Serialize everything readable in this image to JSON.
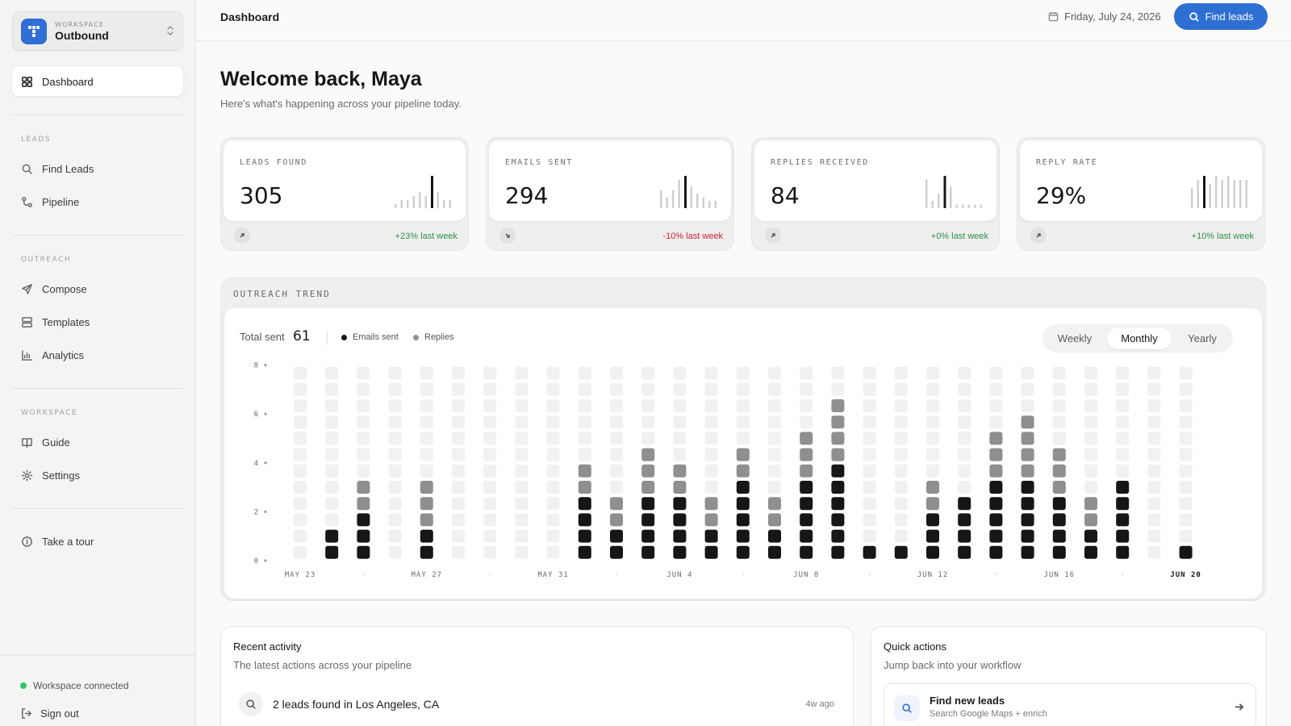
{
  "workspace": {
    "kicker": "WORKSPACE",
    "name": "Outbound"
  },
  "nav": {
    "dashboard": "Dashboard",
    "leads_label": "LEADS",
    "find_leads": "Find Leads",
    "pipeline": "Pipeline",
    "outreach_label": "OUTREACH",
    "compose": "Compose",
    "templates": "Templates",
    "analytics": "Analytics",
    "workspace_label": "WORKSPACE",
    "guide": "Guide",
    "settings": "Settings",
    "tour": "Take a tour"
  },
  "footer": {
    "status": "Workspace connected",
    "signout": "Sign out"
  },
  "header": {
    "title": "Dashboard",
    "date": "Friday, July 24, 2026",
    "find_button": "Find leads"
  },
  "welcome": {
    "title": "Welcome back, Maya",
    "subtitle": "Here's what's happening across your pipeline today."
  },
  "stats": [
    {
      "label": "LEADS FOUND",
      "value": "305",
      "delta": "+23% last week",
      "trend": "up",
      "spark": [
        1,
        2,
        2,
        3,
        4,
        3,
        8,
        4,
        2,
        2
      ]
    },
    {
      "label": "EMAILS SENT",
      "value": "294",
      "delta": "-10% last week",
      "trend": "down",
      "spark": [
        5,
        3,
        5,
        8,
        9,
        6,
        4,
        3,
        2,
        2
      ]
    },
    {
      "label": "REPLIES RECEIVED",
      "value": "84",
      "delta": "+0% last week",
      "trend": "up",
      "spark": [
        8,
        2,
        4,
        9,
        6,
        1,
        1,
        1,
        1,
        1
      ]
    },
    {
      "label": "REPLY RATE",
      "value": "29%",
      "delta": "+10% last week",
      "trend": "up",
      "spark": [
        5,
        7,
        8,
        6,
        8,
        7,
        8,
        7,
        7,
        7
      ]
    }
  ],
  "colors": {
    "accent": "#2e6fd3",
    "positive": "#2d8f4e",
    "negative": "#d0213a",
    "sent": "#161616",
    "replies": "#8f8f8d",
    "empty": "#f1f1f0"
  },
  "trend": {
    "title": "OUTREACH TREND",
    "total_label": "Total sent",
    "total_value": "61",
    "legend_sent": "Emails sent",
    "legend_replies": "Replies",
    "tabs": [
      "Weekly",
      "Monthly",
      "Yearly"
    ],
    "active_tab": "Monthly"
  },
  "chart_data": {
    "type": "bar",
    "title": "",
    "categories": [
      "MAY 23",
      "MAY 24",
      "MAY 25",
      "MAY 26",
      "MAY 27",
      "MAY 28",
      "MAY 29",
      "MAY 30",
      "MAY 31",
      "JUN 1",
      "JUN 2",
      "JUN 3",
      "JUN 4",
      "JUN 5",
      "JUN 6",
      "JUN 7",
      "JUN 8",
      "JUN 9",
      "JUN 10",
      "JUN 11",
      "JUN 12",
      "JUN 13",
      "JUN 14",
      "JUN 15",
      "JUN 16",
      "JUN 17",
      "JUN 18",
      "JUN 19",
      "JUN 20"
    ],
    "tick_labels": [
      "MAY 23",
      "MAY 27",
      "MAY 31",
      "JUN 4",
      "JUN 8",
      "JUN 12",
      "JUN 16",
      "JUN 20"
    ],
    "series": [
      {
        "name": "Emails sent",
        "values": [
          0,
          2,
          3,
          0,
          2,
          0,
          0,
          0,
          0,
          4,
          2,
          4,
          4,
          2,
          5,
          2,
          5,
          6,
          1,
          1,
          3,
          4,
          5,
          5,
          4,
          2,
          5,
          0,
          1
        ]
      },
      {
        "name": "Replies",
        "values": [
          0,
          0,
          2,
          0,
          3,
          0,
          0,
          0,
          0,
          2,
          2,
          3,
          2,
          2,
          2,
          2,
          3,
          4,
          0,
          0,
          2,
          0,
          3,
          4,
          3,
          2,
          0,
          0,
          0
        ]
      }
    ],
    "stacked": true,
    "ylim": [
      0,
      8
    ],
    "yticks": [
      0,
      2,
      4,
      6,
      8
    ],
    "grid": true
  },
  "recent": {
    "title": "Recent activity",
    "subtitle": "The latest actions across your pipeline",
    "items": [
      {
        "text": "2 leads found in Los Angeles, CA",
        "time": "4w ago"
      }
    ]
  },
  "quick": {
    "title": "Quick actions",
    "subtitle": "Jump back into your workflow",
    "items": [
      {
        "title": "Find new leads",
        "subtitle": "Search Google Maps + enrich"
      }
    ]
  }
}
